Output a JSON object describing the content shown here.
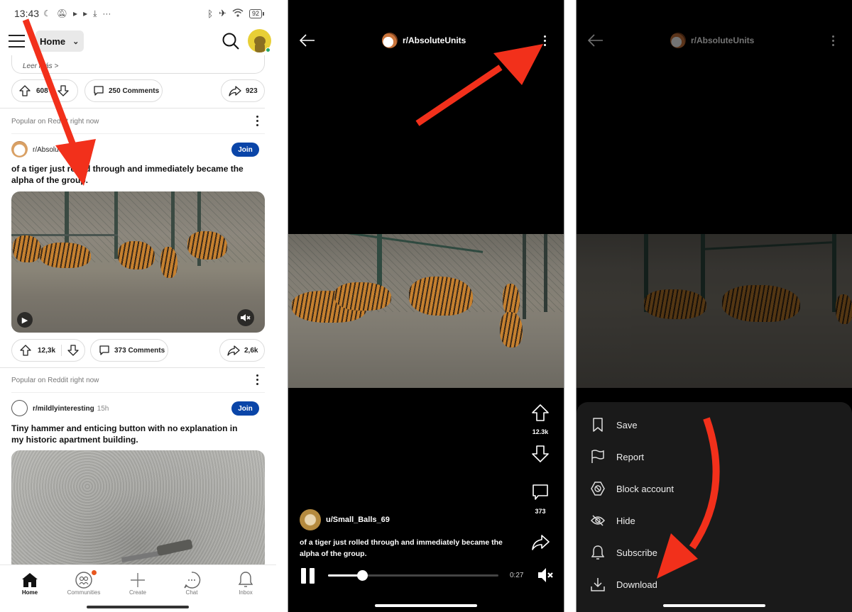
{
  "panel1": {
    "status_bar": {
      "time": "13:43",
      "left_icons": [
        "moon-icon",
        "notifications-off-icon",
        "play-icon",
        "play-icon",
        "download-icon",
        "more-icon"
      ],
      "right_icons": [
        "bluetooth-icon",
        "airplane-icon",
        "wifi-icon"
      ],
      "battery": "92"
    },
    "header": {
      "feed_selector": "Home",
      "search_icon": "search-icon",
      "avatar_icon": "avatar-icon"
    },
    "previous_post": {
      "link_text": "Leer más >",
      "upvotes": "608",
      "comments": "250 Comments",
      "shares": "923"
    },
    "posts": [
      {
        "context": "Popular on Reddit right now",
        "subreddit": "r/AbsoluteUnits",
        "time": "",
        "join_label": "Join",
        "title": "of a tiger just rolled through and immediately became the alpha of the group.",
        "upvotes": "12,3k",
        "comments": "373 Comments",
        "shares": "2,6k"
      },
      {
        "context": "Popular on Reddit right now",
        "subreddit": "r/mildlyinteresting",
        "time": "15h",
        "join_label": "Join",
        "title": "Tiny hammer and enticing button with no explanation in my historic apartment building."
      }
    ],
    "bottom_nav": [
      {
        "label": "Home",
        "icon": "home-icon",
        "active": true
      },
      {
        "label": "Communities",
        "icon": "communities-icon",
        "badge": true
      },
      {
        "label": "Create",
        "icon": "plus-icon"
      },
      {
        "label": "Chat",
        "icon": "chat-icon"
      },
      {
        "label": "Inbox",
        "icon": "bell-icon"
      }
    ]
  },
  "panel2": {
    "subreddit": "r/AbsoluteUnits",
    "upvotes": "12.3k",
    "comments": "373",
    "author": "u/Small_Balls_69",
    "caption": "of a tiger just rolled through and immediately became the alpha of the group.",
    "elapsed": "0:27",
    "progress_fraction": 0.2
  },
  "panel3": {
    "subreddit": "r/AbsoluteUnits",
    "menu": [
      {
        "label": "Save",
        "icon": "bookmark-icon"
      },
      {
        "label": "Report",
        "icon": "flag-icon"
      },
      {
        "label": "Block account",
        "icon": "block-icon"
      },
      {
        "label": "Hide",
        "icon": "eye-off-icon"
      },
      {
        "label": "Subscribe",
        "icon": "bell-icon"
      },
      {
        "label": "Download",
        "icon": "download-icon"
      }
    ]
  },
  "colors": {
    "join_blue": "#0a45a8",
    "arrow_red": "#f2301b",
    "badge_orange": "#e8571f",
    "sheet_bg": "#1a1a1a"
  }
}
